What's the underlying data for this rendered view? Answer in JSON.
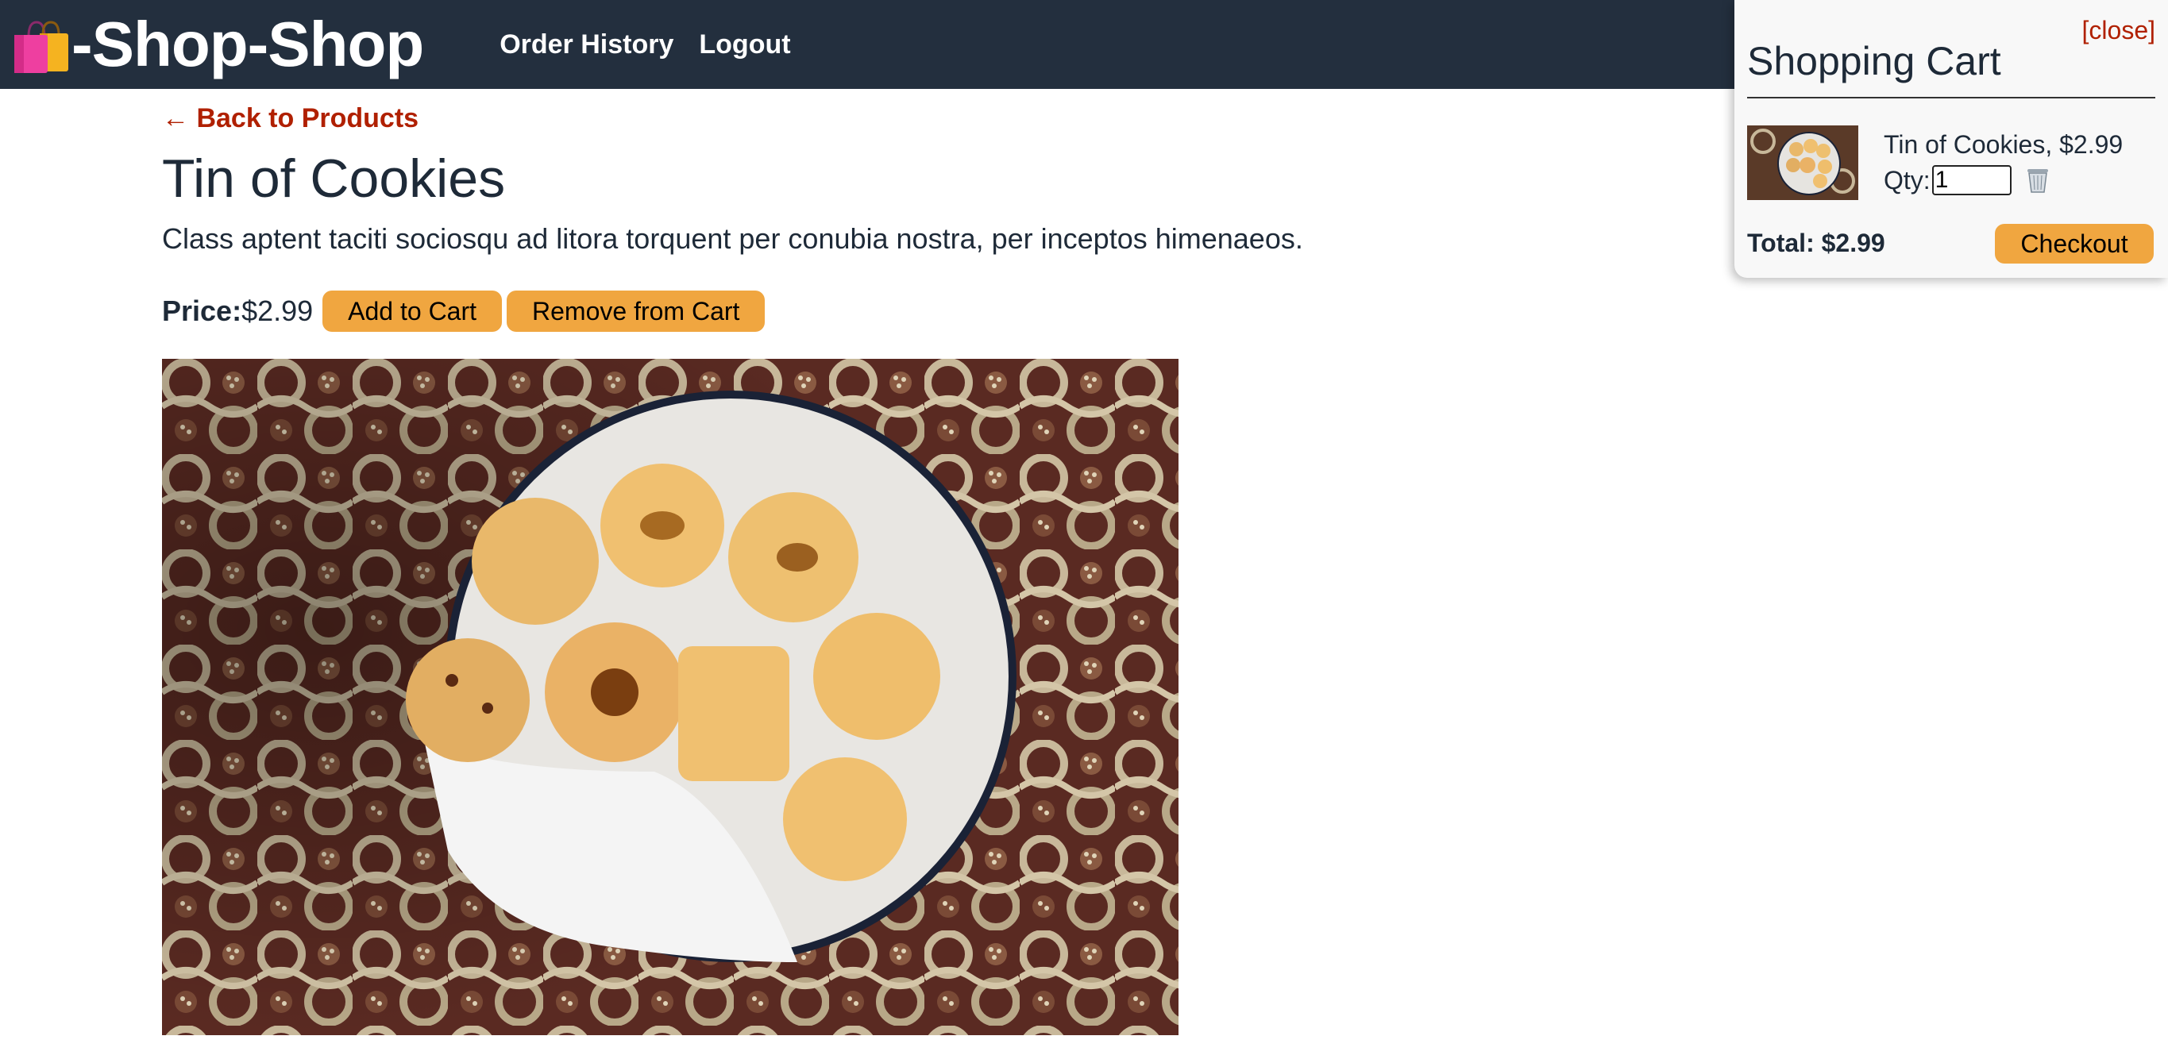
{
  "header": {
    "brand": "-Shop-Shop",
    "brand_icon": "shopping-bags-icon",
    "nav": [
      {
        "label": "Order History"
      },
      {
        "label": "Logout"
      }
    ]
  },
  "main": {
    "back_link": "← Back to Products",
    "title": "Tin of Cookies",
    "description": "Class aptent taciti sociosqu ad litora torquent per conubia nostra, per inceptos himenaeos.",
    "price_label": "Price:",
    "price": "$2.99",
    "add_button": "Add to Cart",
    "remove_button": "Remove from Cart",
    "image_alt": "tin-of-cookies-photo"
  },
  "cart": {
    "close_label": "[close]",
    "title": "Shopping Cart",
    "items": [
      {
        "name": "Tin of Cookies, $2.99",
        "qty_label": "Qty:",
        "qty": "1",
        "remove_icon": "trash-icon"
      }
    ],
    "total": "Total: $2.99",
    "checkout_label": "Checkout"
  },
  "colors": {
    "header_bg": "#232f3e",
    "accent": "#f0a640",
    "link": "#b02000"
  }
}
